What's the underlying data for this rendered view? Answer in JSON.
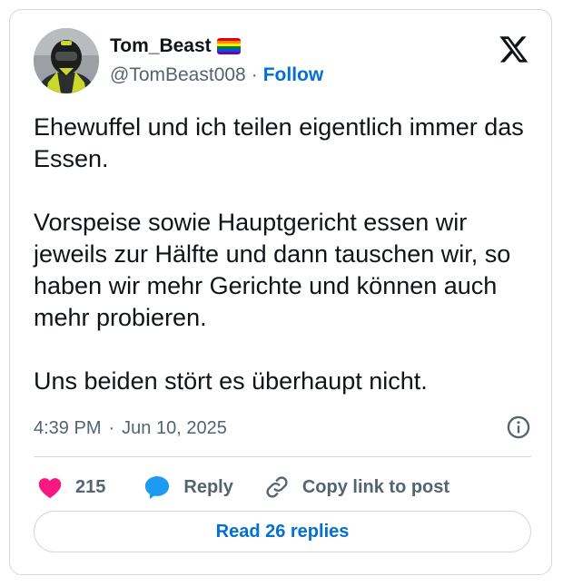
{
  "tweet": {
    "author": {
      "display_name": "Tom_Beast",
      "handle": "@TomBeast008",
      "separator": "·",
      "follow_label": "Follow",
      "flag_icon": "rainbow-flag-icon"
    },
    "text": "Ehewuffel und ich teilen eigentlich immer das Essen.\n\nVorspeise sowie Hauptgericht essen wir jeweils zur Hälfte und dann tauschen wir, so haben wir mehr Gerichte und können auch mehr probieren.\n\nUns beiden stört es überhaupt nicht.",
    "time": "4:39 PM",
    "date_separator": "·",
    "date": "Jun 10, 2025",
    "actions": {
      "like_count": "215",
      "reply_label": "Reply",
      "copy_link_label": "Copy link to post"
    },
    "read_replies_label": "Read 26 replies"
  },
  "colors": {
    "like": "#f91880",
    "reply": "#1d9bf0",
    "link": "#006fd6",
    "secondary_text": "#536471",
    "border": "#cfd9de"
  }
}
